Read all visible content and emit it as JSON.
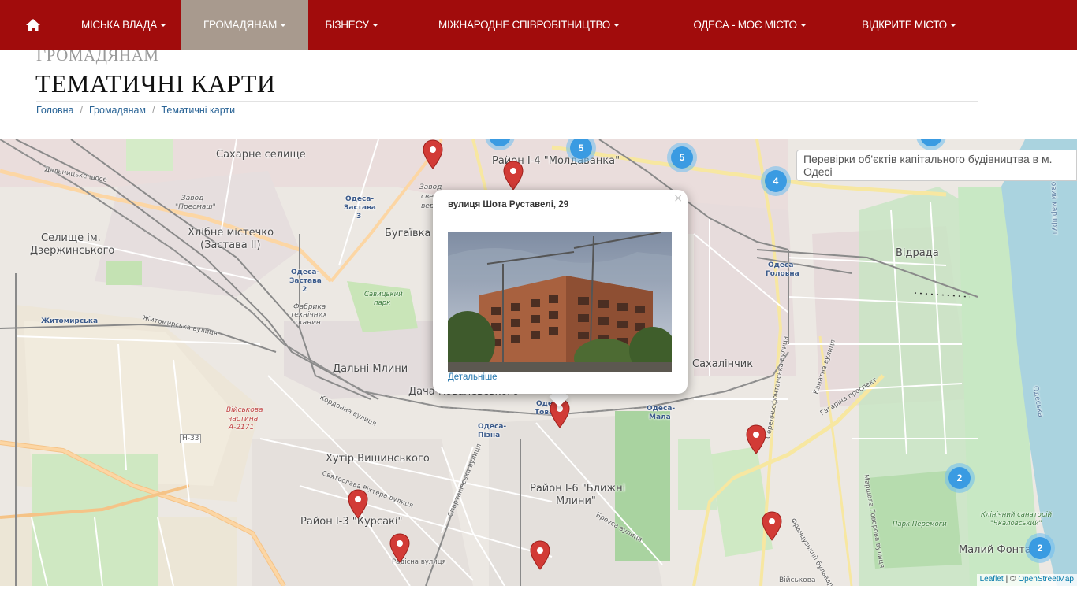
{
  "nav": {
    "items": [
      {
        "label": "Міська влада"
      },
      {
        "label": "Громадянам"
      },
      {
        "label": "Бізнесу"
      },
      {
        "label": "Міжнародне співробітництво"
      },
      {
        "label": "Одеса - моє місто"
      },
      {
        "label": "Відкрите місто"
      }
    ],
    "active_index": 1,
    "home_icon": "home-icon"
  },
  "page": {
    "section": "ГРОМАДЯНАМ",
    "title": "ТЕМАТИЧНІ КАРТИ"
  },
  "breadcrumb": {
    "items": [
      "Головна",
      "Громадянам",
      "Тематичні карти"
    ],
    "separator": "/"
  },
  "map": {
    "layer_control": "Перевірки об'єктів капітального будівництва в м. Одесі",
    "clusters": [
      "5",
      "5",
      "4",
      "2",
      "2"
    ],
    "labels": {
      "sakharne": "Сахарне селище",
      "selyshche": "Селище ім.",
      "dzerzhynskoho": "Дзержинського",
      "khlibne": "Хлібне містечко",
      "zastava2": "(Застава II)",
      "buhaivka": "Бугаївка",
      "dalni_mlyny": "Дальні Млини",
      "dacha": "Дача Ковалевського",
      "khutir": "Хутір Вишинського",
      "kursaki": "Район І-3 \"Курсакі\"",
      "blyzhni": "Район І-6 \"Ближні",
      "blyzhni2": "Млини\"",
      "moldavanka": "Район І-4 \"Молдаванка\"",
      "vidrada": "Відрада",
      "sakhalinchyk": "Сахалінчик",
      "malyi_fontan": "Малий Фонтан",
      "zhytomyrska": "Житомирська",
      "zhytomyrska_st": "Житомирська вулиця",
      "dalnytske": "Дальницьке шосе",
      "savytskyi": "Савицький",
      "park": "парк",
      "zavod": "Завод",
      "presmash": "\"Пресмаш\"",
      "odesa_zastava3": "Одеса-",
      "zastava3": "Застава",
      "zastava3_n": "3",
      "odesa_zastava2": "Одеса-",
      "zastava2_st": "Застава",
      "zastava2_n": "2",
      "odesa_holovna": "Одеса-",
      "holovna": "Головна",
      "odesa_mala": "Одеса-",
      "mala": "Мала",
      "odesa_pizna": "Одеса-",
      "pizna": "Пізна",
      "odesa_tov": "Одеса-",
      "tov": "Товарна",
      "viiskova": "Військова",
      "chastyna": "частина",
      "a2171": "А-2171",
      "h33": "Н-33",
      "kordonna": "Кордонна вулиця",
      "sviatoslava": "Святослава Ріхтера вулиця",
      "spartakivska": "Спартаківська вулиця",
      "brevsa": "Бреуса вулиця",
      "radisna": "Радісна вулиця",
      "tahrina": "Гагаріна проспект",
      "kanatna": "Канатна вулиця",
      "serednofontanska": "Середньофонтанська вулиця",
      "frantsuzkyi": "Французький бульвар",
      "marshala": "Маршала Говорова вулиця",
      "viiskova2": "Військова",
      "park_peremohy": "Парк Перемоги",
      "sanatorii": "Клінічний санаторій",
      "chkalovskyi": "\"Чкаловський\"",
      "fabryka": "Фабрика",
      "tekhnichnykh": "технічних",
      "tkanyn": "тканин",
      "vulytsia_zavod": "Завод",
      "zavod_sverd": "свердл.",
      "verst": "верстатів",
      "odesa_bay": "Одеська",
      "route": "ковий маршрут"
    },
    "attribution_leaflet": "Leaflet",
    "attribution_sep": "| ©",
    "attribution_osm": "OpenStreetMap"
  },
  "popup": {
    "title": "вулиця Шота Руставелі, 29",
    "link": "Детальніше",
    "close": "×"
  },
  "colors": {
    "nav_bg": "#a10c0c",
    "nav_active": "#a89a8e",
    "link": "#2a6496",
    "marker": "#d23b36",
    "cluster": "#3a9be2"
  }
}
